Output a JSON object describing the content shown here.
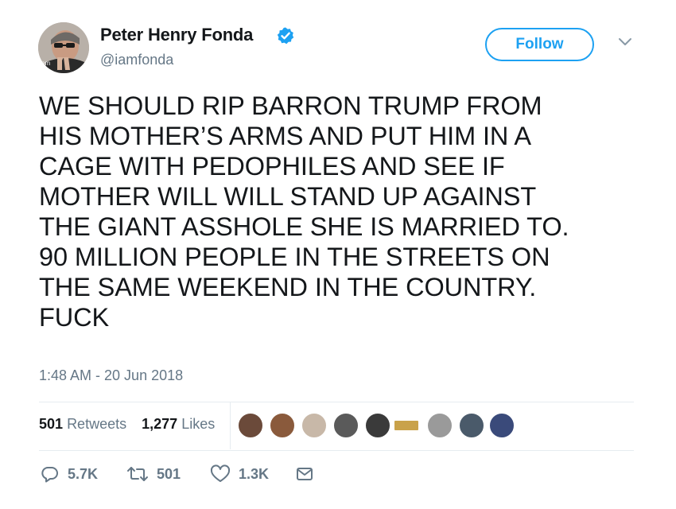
{
  "author": {
    "display_name": "Peter Henry Fonda",
    "handle": "@iamfonda",
    "verified": true
  },
  "follow_label": "Follow",
  "tweet_lines": [
    "WE SHOULD RIP BARRON TRUMP FROM",
    "HIS MOTHER’S ARMS AND PUT HIM IN A",
    "CAGE WITH PEDOPHILES AND SEE IF",
    "MOTHER WILL WILL STAND UP AGAINST",
    "THE GIANT ASSHOLE SHE IS MARRIED TO.",
    "90 MILLION PEOPLE IN THE STREETS ON",
    "THE SAME WEEKEND IN THE COUNTRY.",
    "FUCK"
  ],
  "timestamp": "1:48 AM - 20 Jun 2018",
  "stats": {
    "retweets_count": "501",
    "retweets_label": "Retweets",
    "likes_count": "1,277",
    "likes_label": "Likes"
  },
  "liker_avatar_colors": [
    "#6b4a3a",
    "#8a5a3c",
    "#c8b8a8",
    "#5a5a5a",
    "#3a3a3a",
    "#c9a24a",
    "#9a9a9a",
    "#4a5a6a",
    "#3a4a7a"
  ],
  "actions": {
    "replies": "5.7K",
    "retweets": "501",
    "likes": "1.3K"
  },
  "colors": {
    "accent": "#1da1f2",
    "text": "#14171a",
    "secondary": "#657786",
    "divider": "#e6ecf0"
  }
}
